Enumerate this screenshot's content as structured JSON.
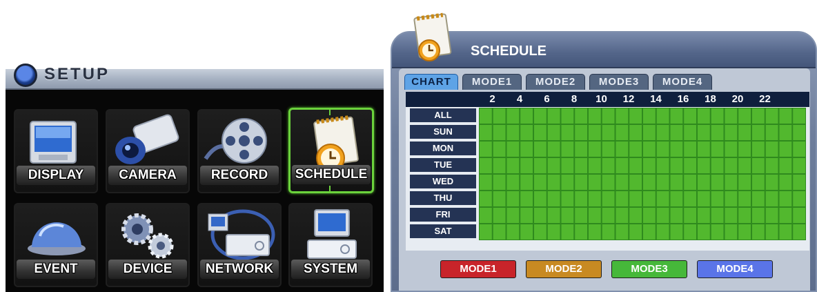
{
  "setup": {
    "title": "SETUP",
    "tiles": [
      {
        "label": "DISPLAY",
        "icon": "monitor-icon",
        "selected": false
      },
      {
        "label": "CAMERA",
        "icon": "camera-icon",
        "selected": false
      },
      {
        "label": "RECORD",
        "icon": "film-reel-icon",
        "selected": false
      },
      {
        "label": "SCHEDULE",
        "icon": "notepad-clock-icon",
        "selected": true
      },
      {
        "label": "EVENT",
        "icon": "dome-camera-icon",
        "selected": false
      },
      {
        "label": "DEVICE",
        "icon": "gears-icon",
        "selected": false
      },
      {
        "label": "NETWORK",
        "icon": "network-icon",
        "selected": false
      },
      {
        "label": "SYSTEM",
        "icon": "computer-icon",
        "selected": false
      }
    ]
  },
  "schedule": {
    "title": "SCHEDULE",
    "tabs": [
      "CHART",
      "MODE1",
      "MODE2",
      "MODE3",
      "MODE4"
    ],
    "active_tab": "CHART",
    "hour_labels": [
      "2",
      "4",
      "6",
      "8",
      "10",
      "12",
      "14",
      "16",
      "18",
      "20",
      "22"
    ],
    "days": [
      "ALL",
      "SUN",
      "MON",
      "TUE",
      "WED",
      "THU",
      "FRI",
      "SAT"
    ],
    "hours_per_day": 24,
    "cell_color": "#52b82e",
    "legend": [
      {
        "label": "MODE1",
        "color": "#c8242a"
      },
      {
        "label": "MODE2",
        "color": "#c88a22"
      },
      {
        "label": "MODE3",
        "color": "#46b83a"
      },
      {
        "label": "MODE4",
        "color": "#5a74e8"
      }
    ]
  }
}
